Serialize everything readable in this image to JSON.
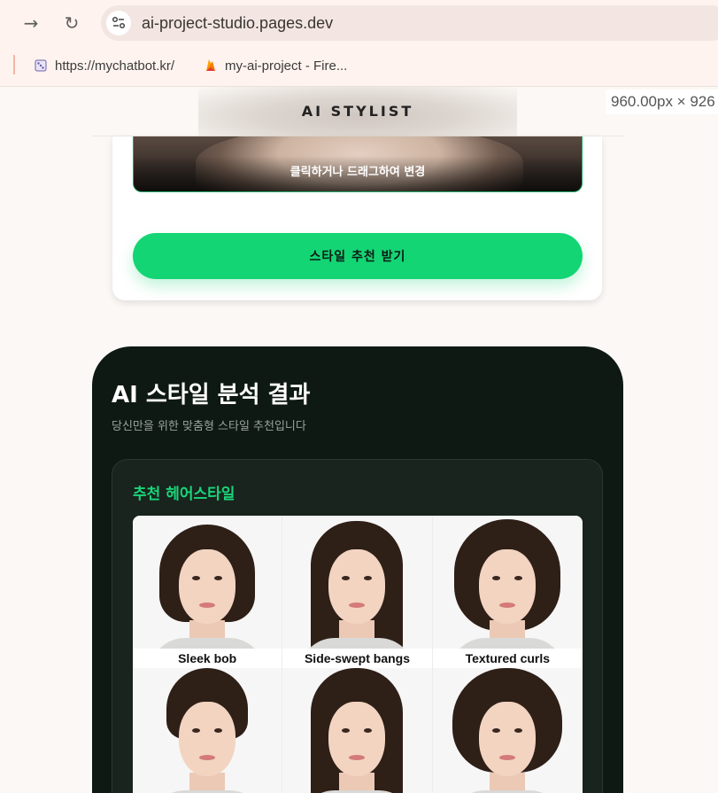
{
  "browser": {
    "url": "ai-project-studio.pages.dev",
    "bookmarks": [
      {
        "label": "https://mychatbot.kr/",
        "icon": "dice-icon"
      },
      {
        "label": "my-ai-project - Fire...",
        "icon": "firebase-icon"
      }
    ],
    "dimension_tooltip": "960.00px × 926"
  },
  "header": {
    "title": "AI STYLIST"
  },
  "upload": {
    "caption": "클릭하거나 드래그하여 변경",
    "cta_label": "스타일 추천 받기"
  },
  "result": {
    "title": "AI 스타일 분석 결과",
    "subtitle": "당신만을 위한 맞춤형 스타일 추천입니다",
    "section_title": "추천 헤어스타일",
    "styles": [
      {
        "name": "Sleek bob"
      },
      {
        "name": "Side-swept bangs"
      },
      {
        "name": "Textured curls"
      },
      {
        "name": ""
      },
      {
        "name": ""
      },
      {
        "name": ""
      }
    ]
  },
  "colors": {
    "accent": "#13d574",
    "dark_bg": "#0e1913",
    "card_bg": "#18241d"
  }
}
